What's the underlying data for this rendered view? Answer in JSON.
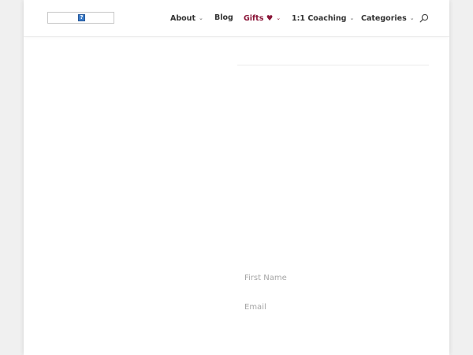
{
  "header": {
    "nav": [
      {
        "label": "About",
        "chevron": "⌄"
      },
      {
        "label": "Blog"
      },
      {
        "label": "Gifts ♥",
        "chevron": "⌄"
      },
      {
        "label": "1:1 Coaching",
        "chevron": "⌄"
      },
      {
        "label": "Categories",
        "chevron": "⌄"
      }
    ],
    "accent_color": "#8a1538",
    "search_icon": "search-icon"
  },
  "logo": {
    "broken_image_glyph": "?"
  },
  "form": {
    "first_name_placeholder": "First Name",
    "email_placeholder": "Email"
  }
}
